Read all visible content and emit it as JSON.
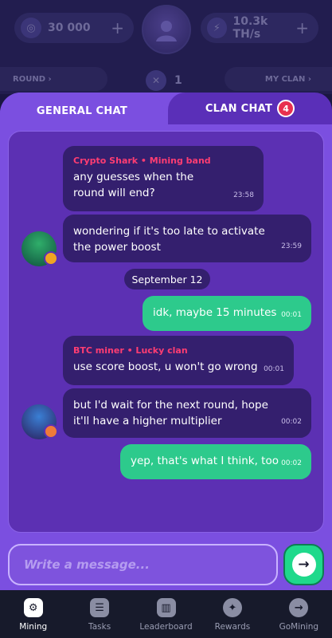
{
  "header": {
    "balance": "30 000",
    "hashrate": "10.3k TH/s",
    "round_label": "ROUND ›",
    "my_clan_label": "MY CLAN ›",
    "multiplier": "1"
  },
  "tabs": {
    "general": "GENERAL CHAT",
    "clan": "CLAN CHAT",
    "clan_badge": "4"
  },
  "messages": [
    {
      "author": "Crypto Shark  •  Mining band",
      "text": "any guesses when the round will end?",
      "time": "23:58"
    },
    {
      "text": "wondering if it's too late to activate the power boost",
      "time": "23:59"
    },
    {
      "date": "September 12"
    },
    {
      "text": "idk, maybe 15 minutes",
      "time": "00:01"
    },
    {
      "author": "BTC miner  •  Lucky clan",
      "text": "use score boost, u won't go wrong",
      "time": "00:01"
    },
    {
      "text": "but I'd wait for the next round, hope it'll have a higher multiplier",
      "time": "00:02"
    },
    {
      "text": "yep, that's what I think, too",
      "time": "00:02"
    }
  ],
  "input": {
    "placeholder": "Write a message..."
  },
  "nav": [
    {
      "label": "Mining",
      "icon": "mining-icon",
      "active": true
    },
    {
      "label": "Tasks",
      "icon": "tasks-icon"
    },
    {
      "label": "Leaderboard",
      "icon": "leaderboard-icon"
    },
    {
      "label": "Rewards",
      "icon": "rewards-icon"
    },
    {
      "label": "GoMining",
      "icon": "gomining-icon"
    }
  ],
  "colors": {
    "panel": "#7b4fe0",
    "chat_bg": "#5c30b3",
    "incoming": "#341f6e",
    "outgoing": "#2dca8c",
    "author": "#ff3d72",
    "send": "#1fd98b",
    "nav_bg": "#171a2b"
  }
}
